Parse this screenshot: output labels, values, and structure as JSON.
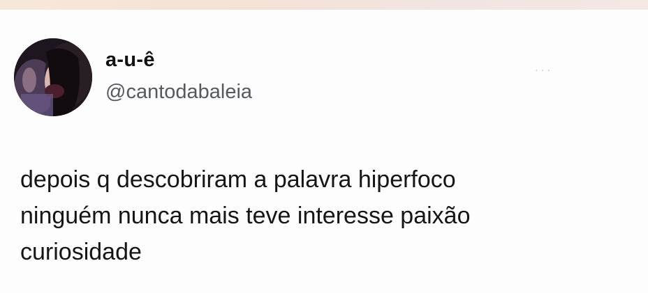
{
  "post": {
    "author": {
      "display_name": "a-u-ê",
      "handle": "@cantodabaleia"
    },
    "more_icon": "ellipsis-icon",
    "text_lines": [
      "depois q descobriram a palavra hiperfoco",
      "ninguém nunca mais teve interesse paixão",
      "curiosidade"
    ]
  },
  "colors": {
    "background": "#fdfdfd",
    "name": "#111111",
    "handle": "#555a60",
    "text": "#151515"
  }
}
